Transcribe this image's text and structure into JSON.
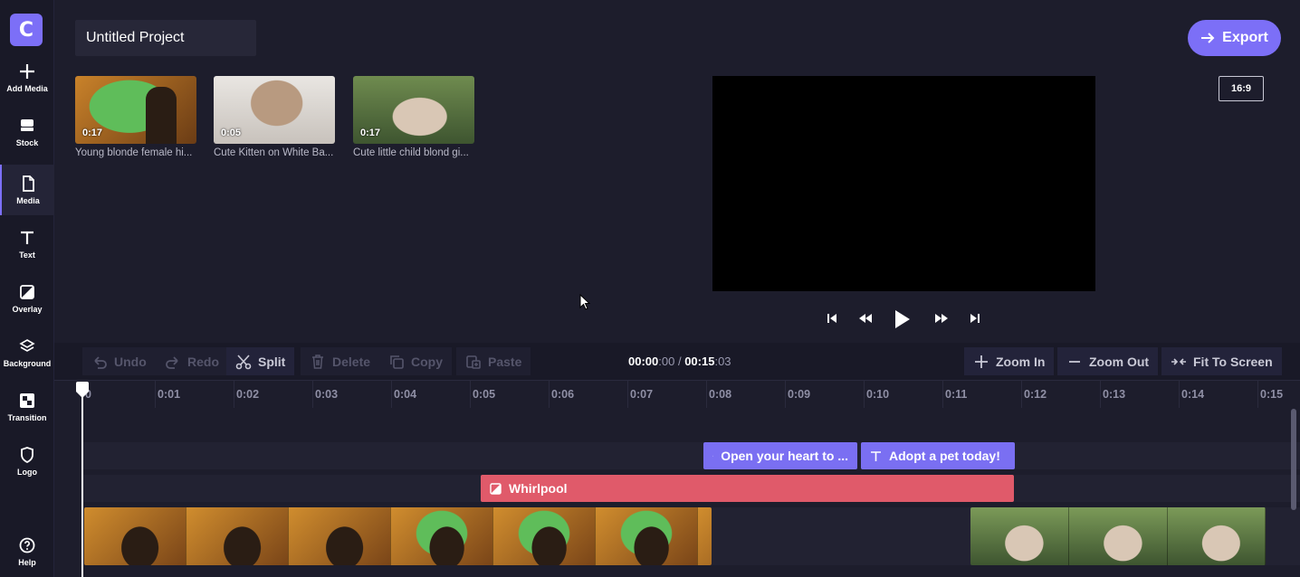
{
  "app": {
    "logo_letter": "C",
    "accent_color": "#7c6ff7"
  },
  "sidebar": {
    "items": [
      {
        "label": "Add Media",
        "icon": "plus-icon"
      },
      {
        "label": "Stock",
        "icon": "stock-icon"
      },
      {
        "label": "Media",
        "icon": "file-icon",
        "active": true
      },
      {
        "label": "Text",
        "icon": "text-icon"
      },
      {
        "label": "Overlay",
        "icon": "overlay-icon"
      },
      {
        "label": "Background",
        "icon": "layers-icon"
      },
      {
        "label": "Transition",
        "icon": "transition-icon"
      },
      {
        "label": "Logo",
        "icon": "shield-icon"
      },
      {
        "label": "Help",
        "icon": "help-icon"
      }
    ]
  },
  "header": {
    "project_title": "Untitled Project",
    "export_label": "Export",
    "aspect_ratio": "16:9"
  },
  "media": [
    {
      "duration": "0:17",
      "name": "Young blonde female hi..."
    },
    {
      "duration": "0:05",
      "name": "Cute Kitten on White Ba..."
    },
    {
      "duration": "0:17",
      "name": "Cute little child blond gi..."
    }
  ],
  "toolbar": {
    "undo": "Undo",
    "redo": "Redo",
    "split": "Split",
    "delete": "Delete",
    "copy": "Copy",
    "paste": "Paste",
    "zoom_in": "Zoom In",
    "zoom_out": "Zoom Out",
    "fit": "Fit To Screen",
    "time_current_main": "00:00",
    "time_current_frames": ":00",
    "time_separator": "/",
    "time_total_main": "00:15",
    "time_total_frames": ":03"
  },
  "ruler": {
    "ticks": [
      "0",
      "0:01",
      "0:02",
      "0:03",
      "0:04",
      "0:05",
      "0:06",
      "0:07",
      "0:08",
      "0:09",
      "0:10",
      "0:11",
      "0:12",
      "0:13",
      "0:14",
      "0:15"
    ]
  },
  "timeline": {
    "text_clips": [
      "Open your heart to ...",
      "Adopt a pet today!"
    ],
    "overlay_clip": "Whirlpool"
  }
}
